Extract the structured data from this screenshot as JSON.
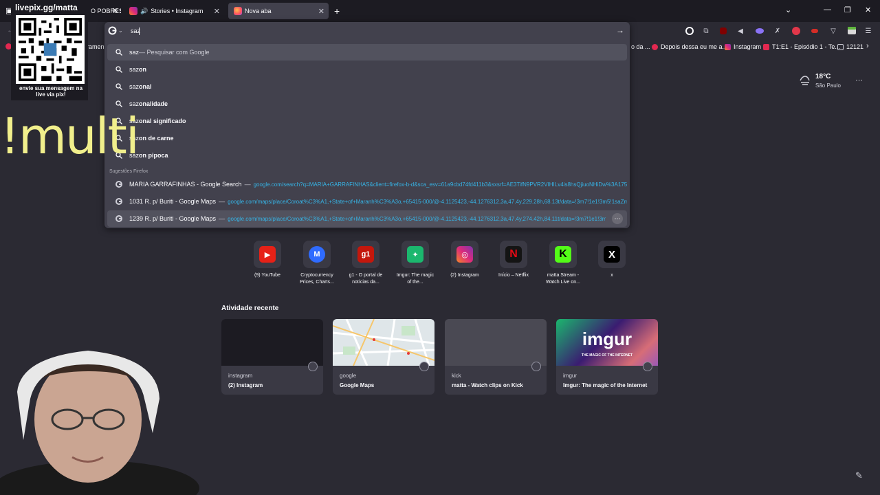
{
  "overlay": {
    "url": "livepix.gg/matta",
    "caption": "envie sua mensagem na live via pix!",
    "multi_command": "!multi"
  },
  "tabs": [
    {
      "label": "O POBRES",
      "active": false
    },
    {
      "label": "Stories • Instagram",
      "active": false
    },
    {
      "label": "Nova aba",
      "active": true
    }
  ],
  "bookmarks": [
    {
      "label": "ramen"
    },
    {
      "label": "o da ..."
    },
    {
      "label": "Depois dessa eu me a..."
    },
    {
      "label": "Instagram"
    },
    {
      "label": "T1:E1 - Episódio 1 - Te..."
    },
    {
      "label": "12121"
    }
  ],
  "urlbar": {
    "value": "saz",
    "go_label": "→"
  },
  "search_suggestions": [
    {
      "bold": "",
      "text": "saz",
      "sub": " — Pesquisar com Google"
    },
    {
      "bold": "on",
      "text": "saz",
      "sub": ""
    },
    {
      "bold": "onal",
      "text": "saz",
      "sub": ""
    },
    {
      "bold": "onalidade",
      "text": "saz",
      "sub": ""
    },
    {
      "bold": "onal significado",
      "text": "saz",
      "sub": ""
    },
    {
      "bold": "on de carne",
      "text": "saz",
      "sub": ""
    },
    {
      "bold": "on pipoca",
      "text": "saz",
      "sub": ""
    }
  ],
  "firefox_suggestions": {
    "heading": "Sugestões Firefox",
    "items": [
      {
        "title": "MARIA GARRAFINHAS - Google Search",
        "url": "google.com/search?q=MARIA+GARRAFINHAS&client=firefox-b-d&sca_esv=61a9cbd74fd411b3&sxsrf=AE3TifN9PVR2VIHILv4is8hsQjiuoNHiDw%3A1754701..."
      },
      {
        "title": "1031 R. p/ Buriti - Google Maps",
        "url": "google.com/maps/place/Coroat%C3%A1,+State+of+Maranh%C3%A3o,+65415-000/@-4.1125423,-44.1276312,3a,47.4y,229.28h,68.13t/data=!3m7!1e1!3m5!1saZmug..."
      },
      {
        "title": "1239 R. p/ Buriti - Google Maps",
        "url": "google.com/maps/place/Coroat%C3%A1,+State+of+Maranh%C3%A3o,+65415-000/@-4.1125423,-44.1276312,3a,47.4y,274.42h,84.11t/data=!3m7!1e1!3m5!1s..."
      }
    ]
  },
  "weather": {
    "temp": "18°C",
    "city": "São Paulo",
    "menu": "⋯"
  },
  "shortcuts": [
    {
      "label": "(9) YouTube",
      "glyph": "▶",
      "color": "#e62117"
    },
    {
      "label": "Cryptocurrency Prices, Charts...",
      "glyph": "M",
      "color": "#2f6bff"
    },
    {
      "label": "g1 - O portal de notícias da...",
      "glyph": "g1",
      "color": "#c4170c"
    },
    {
      "label": "Imgur: The magic of the...",
      "glyph": "✦",
      "color": "#1bb76e"
    },
    {
      "label": "(2) Instagram",
      "glyph": "◎",
      "color": "#e1306c"
    },
    {
      "label": "Início – Netflix",
      "glyph": "N",
      "color": "#141414"
    },
    {
      "label": "matta Stream - Watch Live on...",
      "glyph": "K",
      "color": "#53fc18"
    },
    {
      "label": "x",
      "glyph": "X",
      "color": "#000000"
    }
  ],
  "recent": {
    "heading": "Atividade recente",
    "cards": [
      {
        "source": "instagram",
        "title": "(2) Instagram"
      },
      {
        "source": "google",
        "title": "Google Maps"
      },
      {
        "source": "kick",
        "title": "matta - Watch clips on Kick"
      },
      {
        "source": "imgur",
        "title": "Imgur: The magic of the Internet"
      }
    ],
    "imgur_logo": "imgur",
    "imgur_tagline": "THE MAGIC OF THE INTERNET"
  },
  "colors": {
    "background": "#2b2a33",
    "popup": "#42414d",
    "link": "#36b4e6",
    "accent_yellow": "#f1ef8c"
  }
}
